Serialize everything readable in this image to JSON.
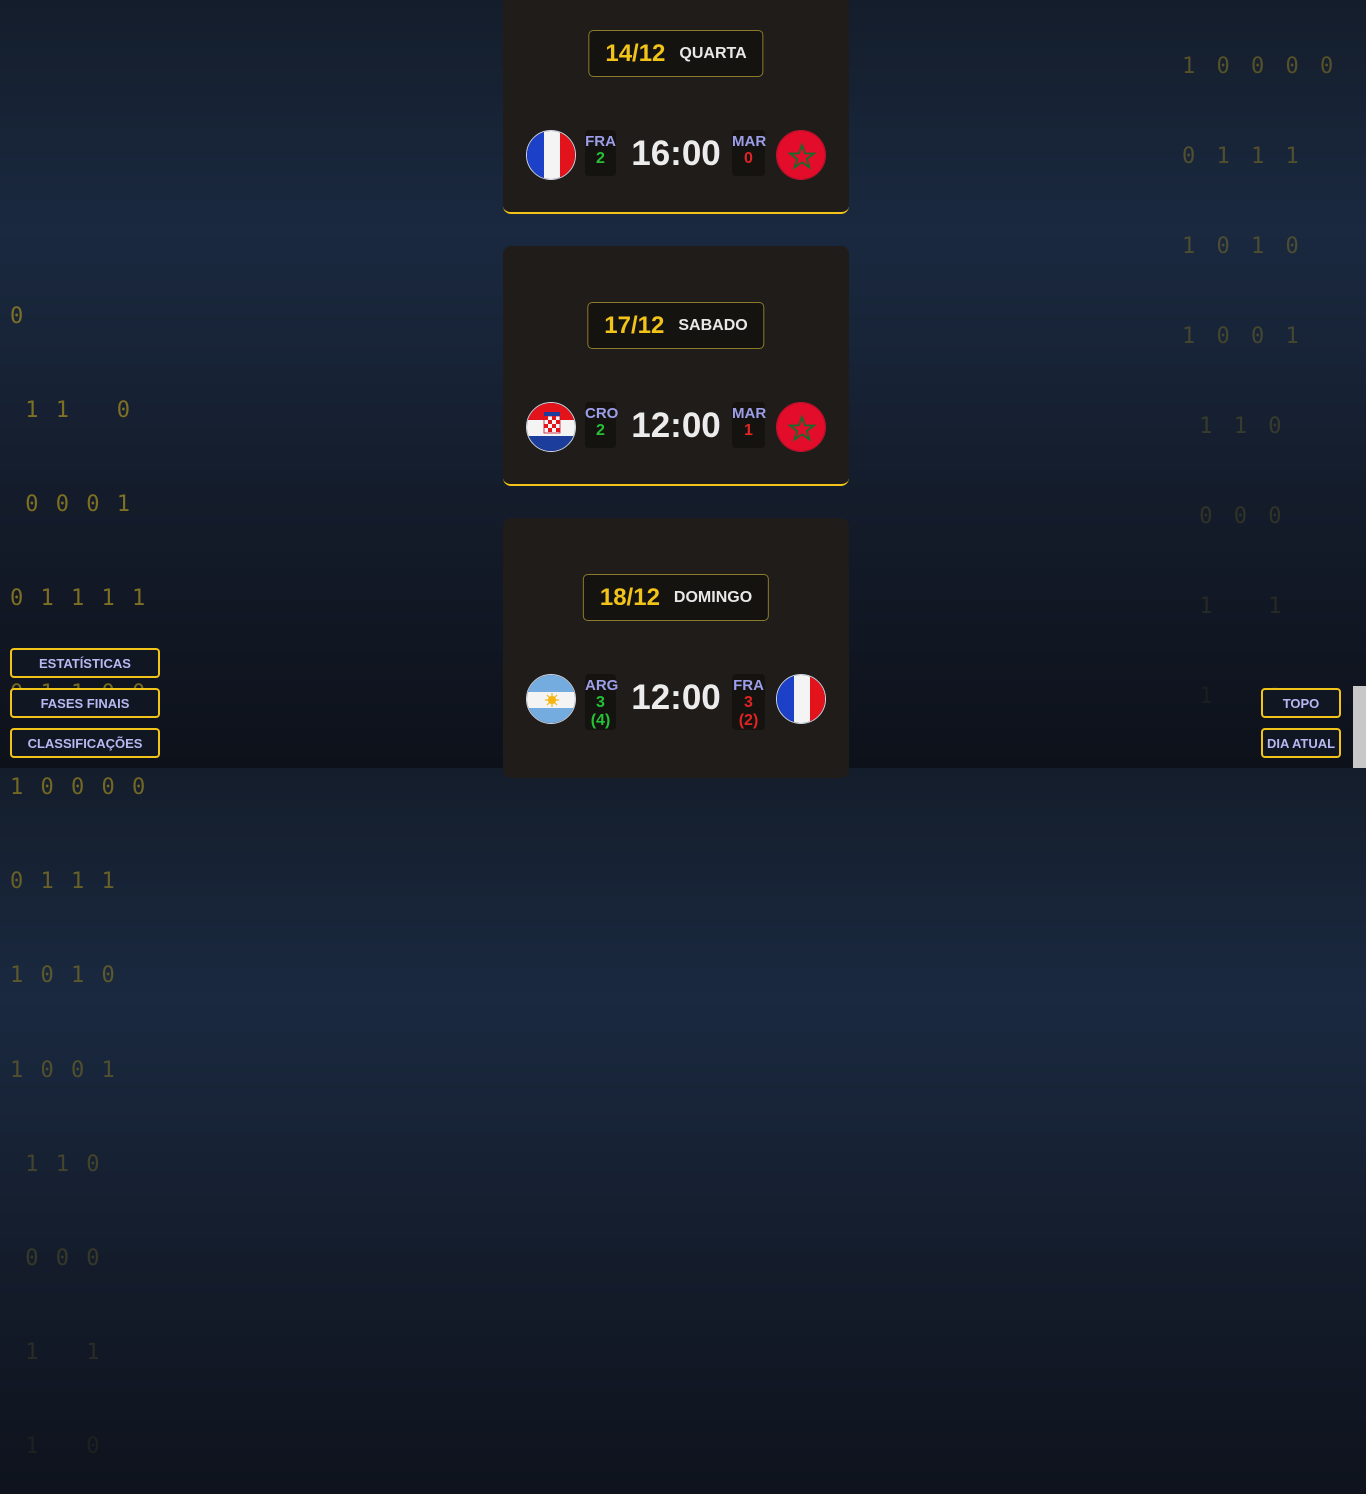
{
  "binary_left": [
    "0",
    " 1 1   0",
    " 0 0 0 1",
    "0 1 1 1 1",
    "0 1 1 0 0",
    "1 0 0 0 0",
    "0 1 1 1",
    "1 0 1 0",
    "1 0 0 1",
    " 1 1 0",
    " 0 0 0",
    " 1   1",
    " 1   0"
  ],
  "binary_right": [
    "1 0 0 0 0",
    "0 1 1 1",
    "1 0 1 0",
    "1 0 0 1",
    " 1 1 0",
    " 0 0 0",
    " 1   1",
    " 1   0"
  ],
  "matches": [
    {
      "date": "14/12",
      "weekday": "QUARTA",
      "time": "16:00",
      "home": {
        "code": "FRA",
        "score": "2",
        "flag": "france-flag"
      },
      "away": {
        "code": "MAR",
        "score": "0",
        "flag": "morocco-flag"
      }
    },
    {
      "date": "17/12",
      "weekday": "SABADO",
      "time": "12:00",
      "home": {
        "code": "CRO",
        "score": "2",
        "flag": "croatia-flag"
      },
      "away": {
        "code": "MAR",
        "score": "1",
        "flag": "morocco-flag"
      }
    },
    {
      "date": "18/12",
      "weekday": "DOMINGO",
      "time": "12:00",
      "home": {
        "code": "ARG",
        "score": "3",
        "penalties": "(4)",
        "flag": "argentina-flag"
      },
      "away": {
        "code": "FRA",
        "score": "3",
        "penalties": "(2)",
        "flag": "france-flag"
      }
    }
  ],
  "nav_left": {
    "stats": "ESTATÍSTICAS",
    "finals": "FASES FINAIS",
    "standings": "CLASSIFICAÇÕES"
  },
  "nav_right": {
    "top": "TOPO",
    "today": "DIA ATUAL"
  },
  "colors": {
    "accent": "#f2c318",
    "win": "#25c235",
    "lose": "#e02424",
    "team_code": "#9d9eea"
  }
}
